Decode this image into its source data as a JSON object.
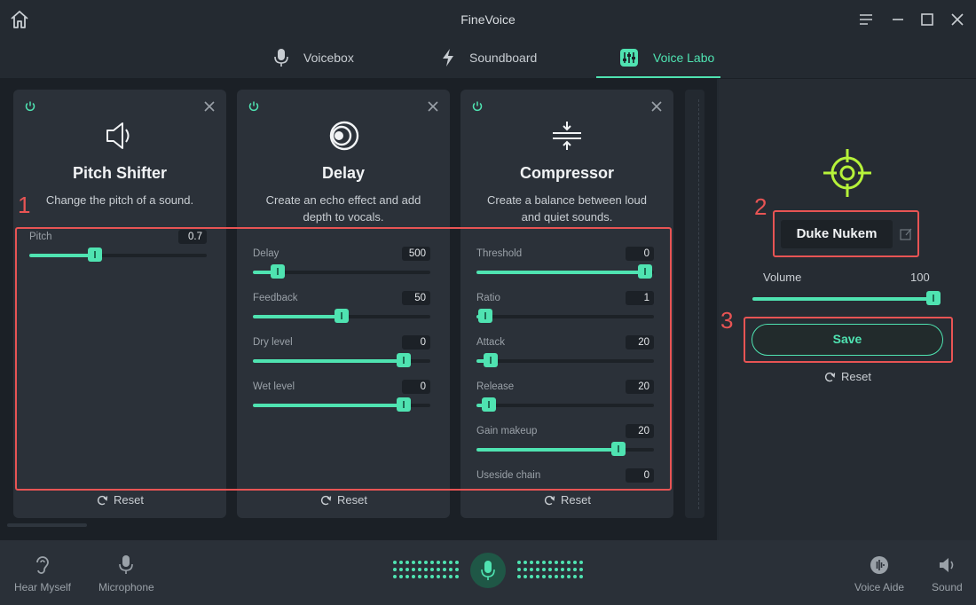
{
  "app": {
    "title": "FineVoice"
  },
  "tabs": [
    {
      "label": "Voicebox",
      "icon": "microphone-icon",
      "active": false
    },
    {
      "label": "Soundboard",
      "icon": "lightning-icon",
      "active": false
    },
    {
      "label": "Voice Labo",
      "icon": "equalizer-icon",
      "active": true
    }
  ],
  "cards": [
    {
      "title": "Pitch Shifter",
      "icon": "speaker-icon",
      "description": "Change the pitch of a sound.",
      "params": [
        {
          "label": "Pitch",
          "value": "0.7",
          "fraction": 0.37
        }
      ],
      "reset": "Reset"
    },
    {
      "title": "Delay",
      "icon": "echo-circles-icon",
      "description": "Create an echo effect and add depth to vocals.",
      "params": [
        {
          "label": "Delay",
          "value": "500",
          "fraction": 0.14
        },
        {
          "label": "Feedback",
          "value": "50",
          "fraction": 0.5
        },
        {
          "label": "Dry level",
          "value": "0",
          "fraction": 0.85
        },
        {
          "label": "Wet level",
          "value": "0",
          "fraction": 0.85
        }
      ],
      "reset": "Reset"
    },
    {
      "title": "Compressor",
      "icon": "compress-icon",
      "description": "Create a balance between loud and quiet sounds.",
      "params": [
        {
          "label": "Threshold",
          "value": "0",
          "fraction": 0.95
        },
        {
          "label": "Ratio",
          "value": "1",
          "fraction": 0.05
        },
        {
          "label": "Attack",
          "value": "20",
          "fraction": 0.08
        },
        {
          "label": "Release",
          "value": "20",
          "fraction": 0.07
        },
        {
          "label": "Gain makeup",
          "value": "20",
          "fraction": 0.8
        },
        {
          "label": "Useside chain",
          "value": "0",
          "fraction": null
        }
      ],
      "reset": "Reset"
    }
  ],
  "annotations": [
    "1",
    "2",
    "3"
  ],
  "voice": {
    "name": "Duke Nukem",
    "volume_label": "Volume",
    "volume_value": "100",
    "volume_fraction": 0.96,
    "save_label": "Save",
    "reset_label": "Reset"
  },
  "bottom": {
    "hear_myself": "Hear Myself",
    "microphone": "Microphone",
    "voice_aide": "Voice Aide",
    "sound": "Sound"
  },
  "colors": {
    "accent": "#4fe3b1",
    "annotation": "#e85454",
    "target": "#b6f23a"
  }
}
